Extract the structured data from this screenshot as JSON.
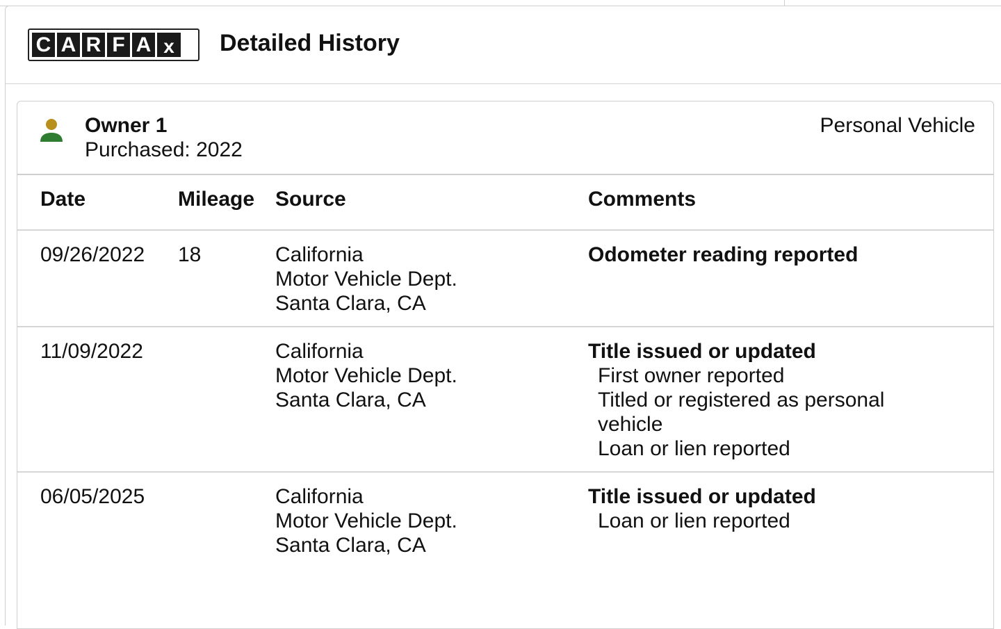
{
  "header": {
    "logo_letters": [
      "C",
      "A",
      "R",
      "F",
      "A",
      "x"
    ],
    "title": "Detailed History"
  },
  "owner": {
    "name": "Owner 1",
    "purchased": "Purchased: 2022",
    "vehicle_type": "Personal Vehicle",
    "icon": "person-icon",
    "icon_colors": {
      "head": "#b8901c",
      "body": "#2e7d32"
    }
  },
  "table": {
    "columns": [
      "Date",
      "Mileage",
      "Source",
      "Comments"
    ],
    "rows": [
      {
        "date": "09/26/2022",
        "mileage": "18",
        "source": [
          "California",
          "Motor Vehicle Dept.",
          "Santa Clara, CA"
        ],
        "comment_title": "Odometer reading reported",
        "comment_items": []
      },
      {
        "date": "11/09/2022",
        "mileage": "",
        "source": [
          "California",
          "Motor Vehicle Dept.",
          "Santa Clara, CA"
        ],
        "comment_title": "Title issued or updated",
        "comment_items": [
          "First owner reported",
          "Titled or registered as personal vehicle",
          "Loan or lien reported"
        ]
      },
      {
        "date": "06/05/2025",
        "mileage": "",
        "source": [
          "California",
          "Motor Vehicle Dept.",
          "Santa Clara, CA"
        ],
        "comment_title": "Title issued or updated",
        "comment_items": [
          "Loan or lien reported"
        ]
      }
    ]
  }
}
